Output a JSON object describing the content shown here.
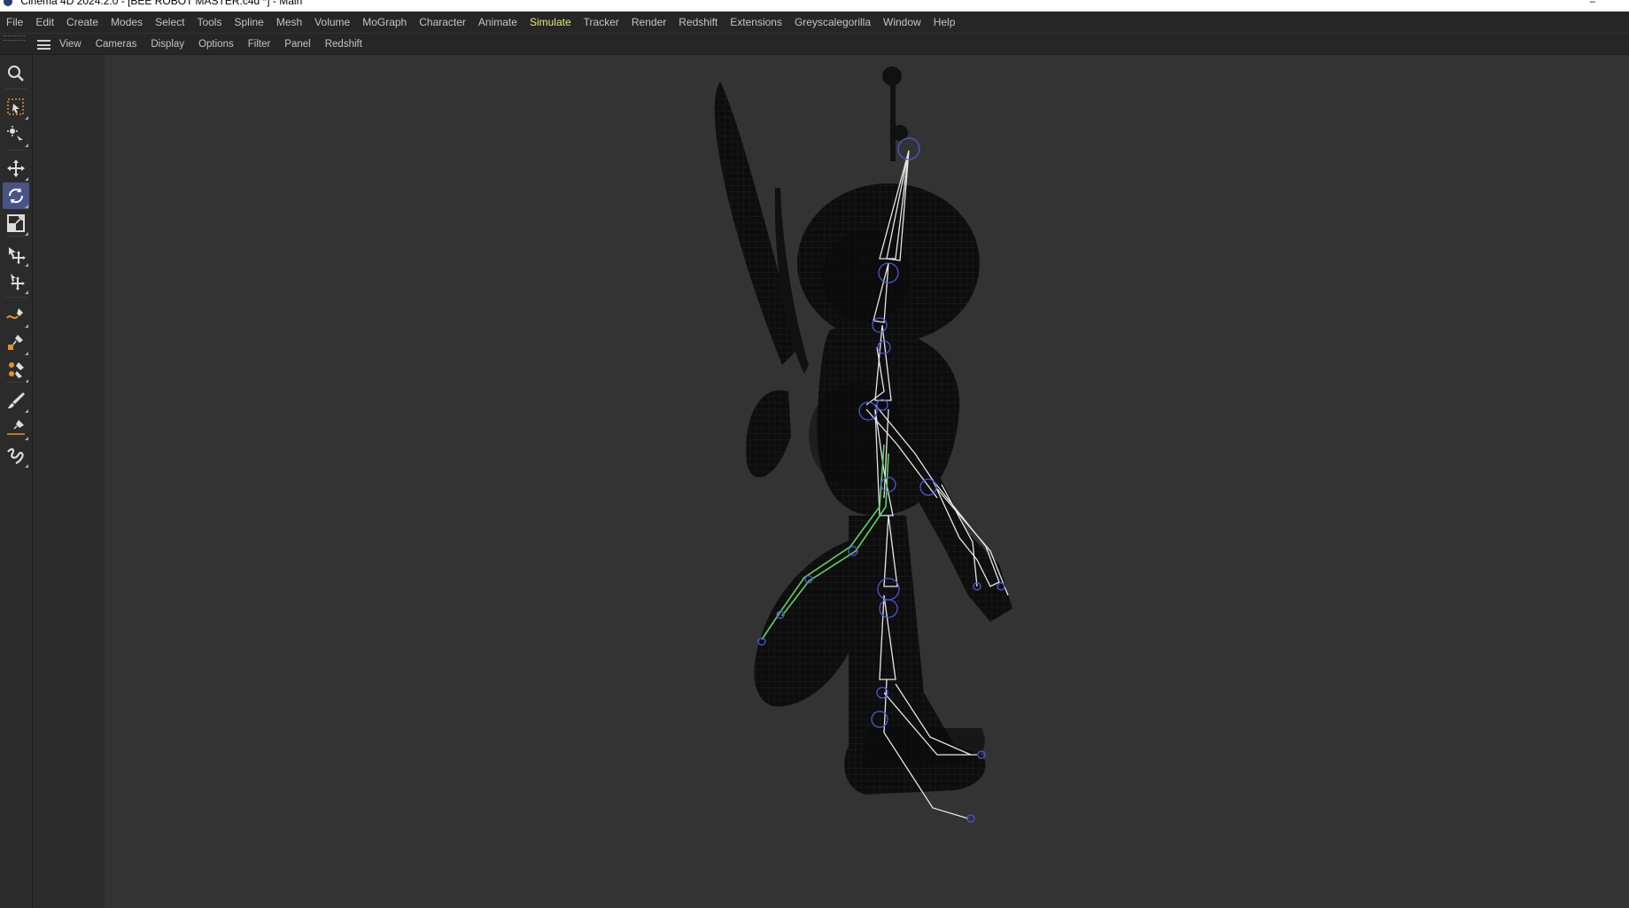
{
  "window": {
    "title": "Cinema 4D 2024.2.0 - [BEE ROBOT MASTER.c4d *] - Main"
  },
  "menubar": {
    "items": [
      "File",
      "Edit",
      "Create",
      "Modes",
      "Select",
      "Tools",
      "Spline",
      "Mesh",
      "Volume",
      "MoGraph",
      "Character",
      "Animate",
      "Simulate",
      "Tracker",
      "Render",
      "Redshift",
      "Extensions",
      "Greyscalegorilla",
      "Window",
      "Help"
    ],
    "active": "Simulate",
    "active_color": "#e6ea7a"
  },
  "viewport_menu": {
    "items": [
      "View",
      "Cameras",
      "Display",
      "Options",
      "Filter",
      "Panel",
      "Redshift"
    ]
  },
  "toolbar": {
    "tools": [
      {
        "icon": "search-icon"
      },
      {
        "icon": "live-selection-icon"
      },
      {
        "icon": "transform-icon"
      },
      {
        "icon": "move-icon"
      },
      {
        "icon": "rotate-icon",
        "active": true
      },
      {
        "icon": "scale-icon"
      },
      {
        "icon": "pose-morph-move-icon"
      },
      {
        "icon": "joint-align-icon"
      },
      {
        "icon": "spline-pen-icon"
      },
      {
        "icon": "paint-weights-icon"
      },
      {
        "icon": "weight-brush-icon"
      },
      {
        "icon": "brush-icon"
      },
      {
        "icon": "knife-icon"
      },
      {
        "icon": "sketch-icon"
      }
    ],
    "active_color": "#4a5385",
    "accent_color": "#e8902a"
  },
  "viewport": {
    "background": "#333333",
    "scene": "wireframe-bee-robot-with-joints",
    "mesh_color": "#0d0d0d",
    "joint_color": "#e6e6e6",
    "selected_joint_color": "#5fd35f",
    "joint_marker_color": "#4a58d8"
  }
}
